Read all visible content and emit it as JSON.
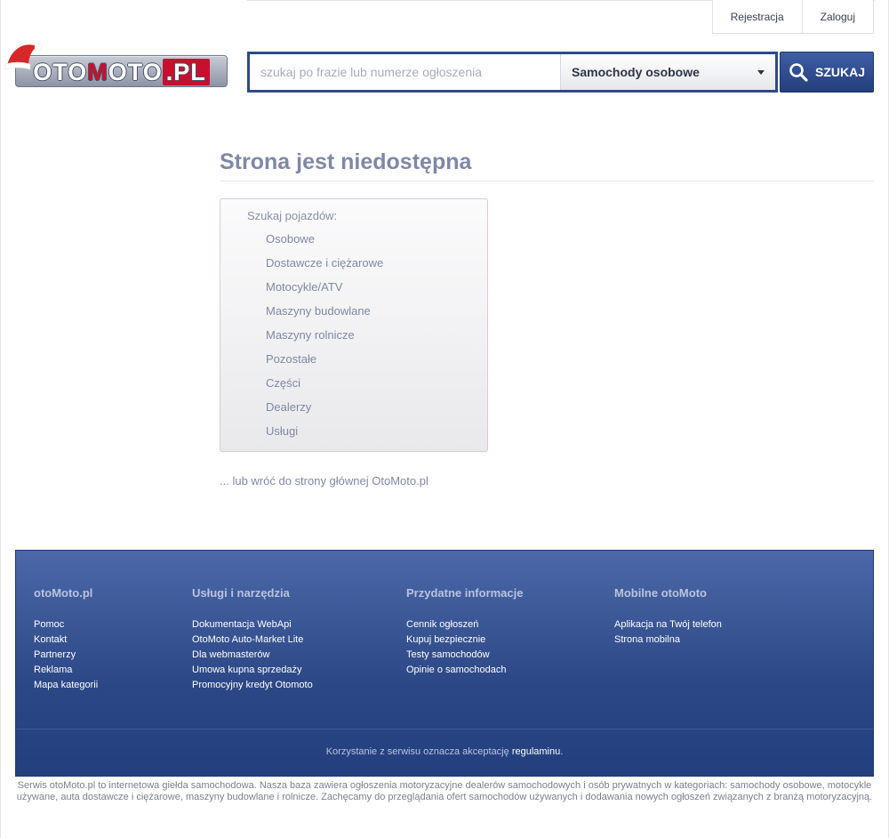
{
  "header": {
    "register_label": "Rejestracja",
    "login_label": "Zaloguj",
    "logo": {
      "brand_word_1": "OTO",
      "brand_letter_m": "M",
      "brand_word_2": "OTO",
      "brand_suffix": ".PL"
    }
  },
  "search": {
    "placeholder": "szukaj po frazie lub numerze ogłoszenia",
    "value": "",
    "category_selected": "Samochody osobowe",
    "button_label": "SZUKAJ"
  },
  "main": {
    "title": "Strona jest niedostępna",
    "panel_heading": "Szukaj pojazdów:",
    "categories": [
      "Osobowe",
      "Dostawcze i ciężarowe",
      "Motocykle/ATV",
      "Maszyny budowlane",
      "Maszyny rolnicze",
      "Pozostałe",
      "Części",
      "Dealerzy",
      "Usługi"
    ],
    "back_link": "... lub wróć do strony głównej OtoMoto.pl"
  },
  "footer": {
    "columns": [
      {
        "heading": "otoMoto.pl",
        "links": [
          "Pomoc",
          "Kontakt",
          "Partnerzy",
          "Reklama",
          "Mapa kategorii"
        ]
      },
      {
        "heading": "Usługi i narzędzia",
        "links": [
          "Dokumentacja WebApi",
          "OtoMoto Auto-Market Lite",
          "Dla webmasterów",
          "Umowa kupna sprzedaży",
          "Promocyjny kredyt Otomoto"
        ]
      },
      {
        "heading": "Przydatne informacje",
        "links": [
          "Cennik ogłoszeń",
          "Kupuj bezpiecznie",
          "Testy samochodów",
          "Opinie o samochodach"
        ]
      },
      {
        "heading": "Mobilne otoMoto",
        "links": [
          "Aplikacja na Twój telefon",
          "Strona mobilna"
        ]
      }
    ],
    "terms_prefix": "Korzystanie z serwisu oznacza akceptację ",
    "terms_link": "regulaminu",
    "terms_suffix": ".",
    "about": "Serwis otoMoto.pl to internetowa giełda samochodowa. Nasza baza zawiera ogłoszenia motoryzacyjne dealerów samochodowych i osób prywatnych w kategoriach: samochody osobowe, motocykle używane, auta dostawcze i ciężarowe, maszyny budowlane i rolnicze. Zachęcamy do przeglądania ofert samochodów używanych i dodawania nowych ogłoszeń związanych z branżą motoryzacyjną."
  },
  "colors": {
    "brand_blue": "#2e4a8a",
    "brand_red": "#c8102e",
    "title_gray": "#7f88a6"
  }
}
